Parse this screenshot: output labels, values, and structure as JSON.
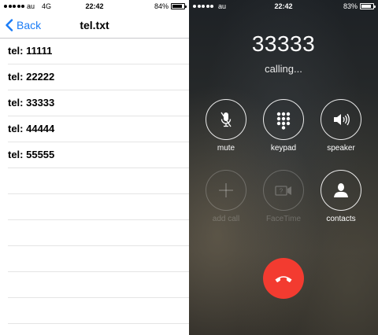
{
  "left": {
    "status": {
      "carrier": "au",
      "network": "4G",
      "time": "22:42",
      "battery": "84%",
      "battery_level": 0.84
    },
    "nav": {
      "back_label": "Back",
      "title": "tel.txt"
    },
    "lines": [
      "tel: 11111",
      "tel: 22222",
      "tel: 33333",
      "tel: 44444",
      "tel: 55555",
      "",
      "",
      "",
      "",
      "",
      "",
      ""
    ]
  },
  "right": {
    "status": {
      "carrier": "au",
      "time": "22:42",
      "battery": "83%",
      "battery_level": 0.83
    },
    "number": "33333",
    "call_status": "calling...",
    "buttons": {
      "mute": "mute",
      "keypad": "keypad",
      "speaker": "speaker",
      "add_call": "add call",
      "facetime": "FaceTime",
      "contacts": "contacts"
    },
    "colors": {
      "end_call": "#f33b30",
      "accent": "#1a7cf6"
    }
  }
}
